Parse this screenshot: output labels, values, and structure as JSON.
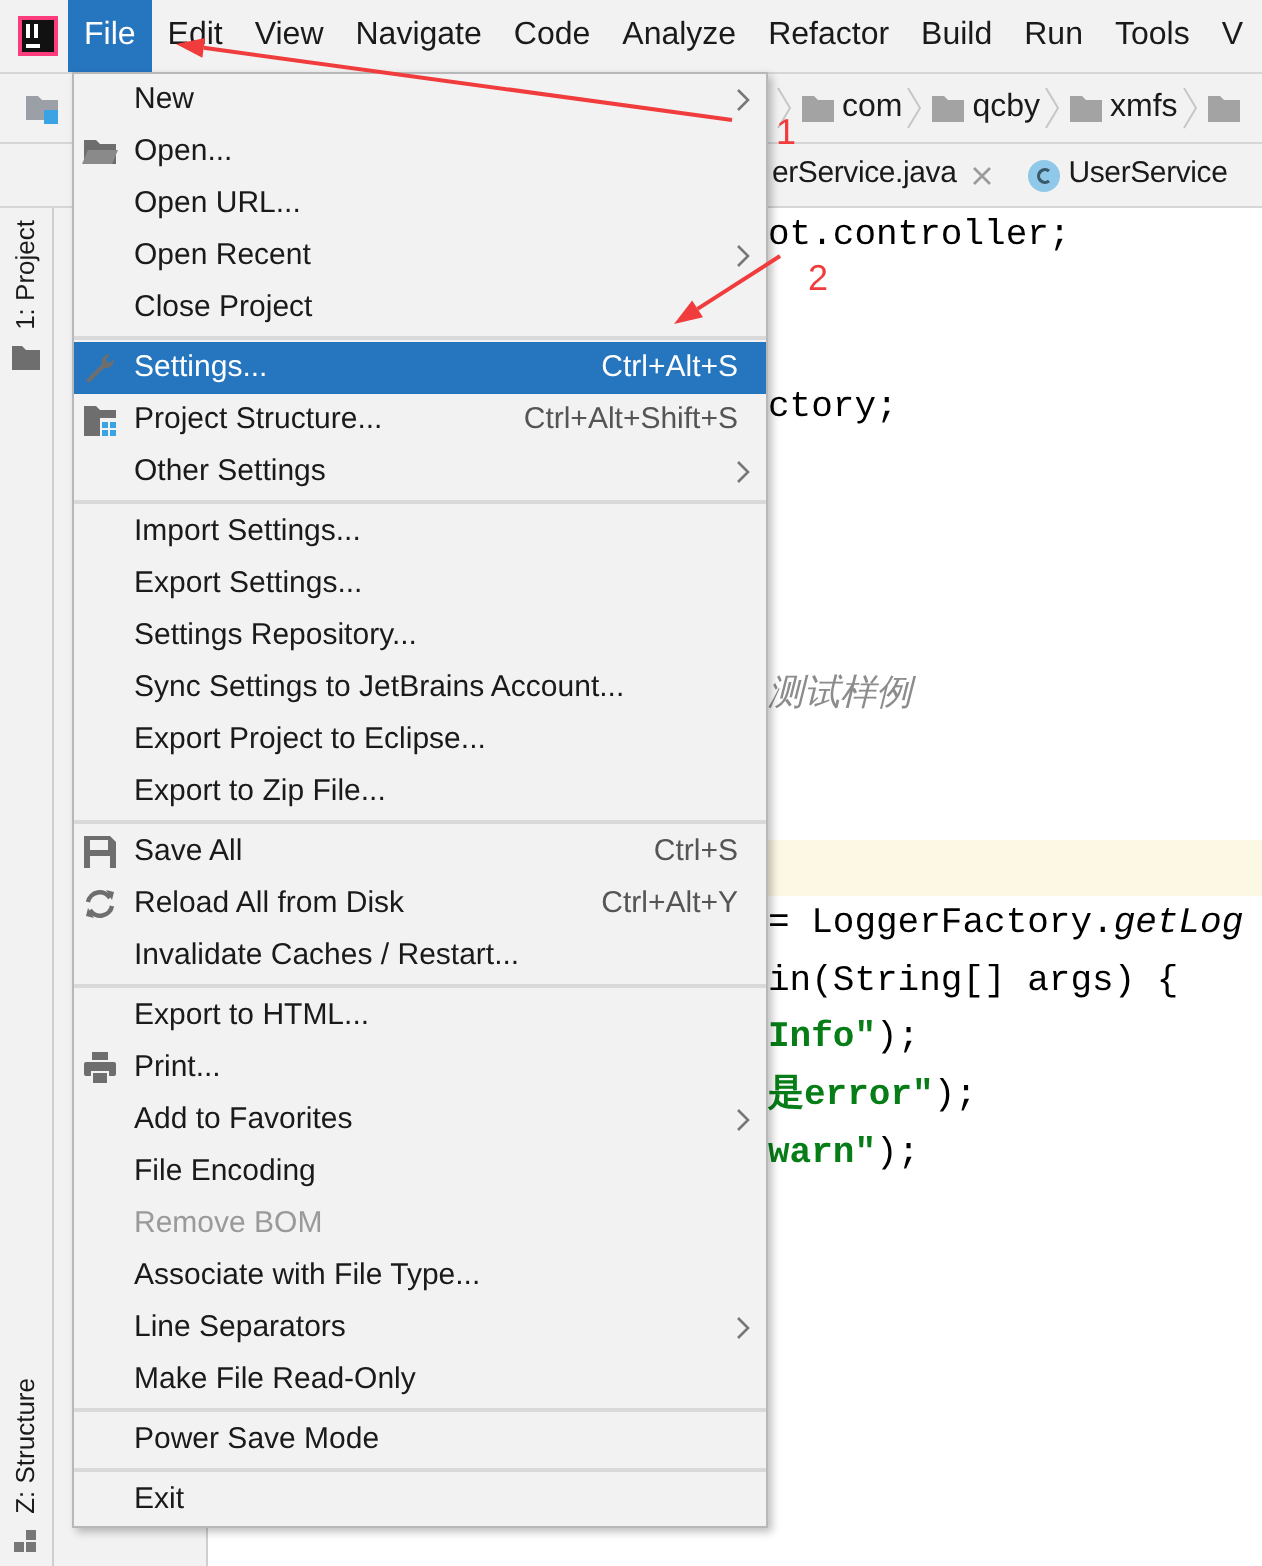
{
  "menubar": [
    {
      "label": "File",
      "selected": true
    },
    {
      "label": "Edit",
      "selected": false
    },
    {
      "label": "View",
      "selected": false
    },
    {
      "label": "Navigate",
      "selected": false
    },
    {
      "label": "Code",
      "selected": false
    },
    {
      "label": "Analyze",
      "selected": false
    },
    {
      "label": "Refactor",
      "selected": false
    },
    {
      "label": "Build",
      "selected": false
    },
    {
      "label": "Run",
      "selected": false
    },
    {
      "label": "Tools",
      "selected": false
    },
    {
      "label": "V",
      "selected": false
    }
  ],
  "breadcrumbs": [
    "com",
    "qcby",
    "xmfs"
  ],
  "editor_tabs": [
    {
      "label": "erService.java",
      "kind": "closable"
    },
    {
      "label": "UserService",
      "kind": "class"
    }
  ],
  "tool_strip": {
    "top": "1: Project",
    "bottom": "Z: Structure"
  },
  "code_lines": [
    {
      "kind": "code",
      "segments": [
        {
          "text": "ot.controller;",
          "kind": "plain"
        }
      ]
    },
    {
      "kind": "blank"
    },
    {
      "kind": "blank"
    },
    {
      "kind": "code",
      "segments": [
        {
          "text": "ctory;",
          "kind": "plain"
        }
      ]
    },
    {
      "kind": "blank"
    },
    {
      "kind": "blank"
    },
    {
      "kind": "blank"
    },
    {
      "kind": "blank"
    },
    {
      "kind": "code",
      "segments": [
        {
          "text": "测试样例",
          "kind": "comment"
        }
      ]
    },
    {
      "kind": "blank"
    },
    {
      "kind": "blank"
    },
    {
      "kind": "blank",
      "current": true
    },
    {
      "kind": "code",
      "segments": [
        {
          "text": "= LoggerFactory.",
          "kind": "plain"
        },
        {
          "text": "getLog",
          "kind": "italic"
        }
      ]
    },
    {
      "kind": "code",
      "segments": [
        {
          "text": "in(String[] args) {",
          "kind": "plain"
        }
      ]
    },
    {
      "kind": "code",
      "segments": [
        {
          "text": "Info\"",
          "kind": "string"
        },
        {
          "text": ");",
          "kind": "plain"
        }
      ]
    },
    {
      "kind": "code",
      "segments": [
        {
          "text": "是error\"",
          "kind": "string"
        },
        {
          "text": ");",
          "kind": "plain"
        }
      ]
    },
    {
      "kind": "code",
      "segments": [
        {
          "text": "warn\"",
          "kind": "string"
        },
        {
          "text": ");",
          "kind": "plain"
        }
      ]
    }
  ],
  "file_menu": {
    "groups": [
      [
        {
          "label": "New",
          "submenu": true,
          "selected": false,
          "disabled": false
        },
        {
          "label": "Open...",
          "kind": "folder",
          "submenu": false,
          "selected": false,
          "disabled": false
        },
        {
          "label": "Open URL...",
          "submenu": false,
          "selected": false,
          "disabled": false
        },
        {
          "label": "Open Recent",
          "submenu": true,
          "selected": false,
          "disabled": false
        },
        {
          "label": "Close Project",
          "submenu": false,
          "selected": false,
          "disabled": false
        }
      ],
      [
        {
          "label": "Settings...",
          "kind": "wrench",
          "shortcut": "Ctrl+Alt+S",
          "submenu": false,
          "selected": true,
          "disabled": false
        },
        {
          "label": "Project Structure...",
          "kind": "structure",
          "shortcut": "Ctrl+Alt+Shift+S",
          "submenu": false,
          "selected": false,
          "disabled": false
        },
        {
          "label": "Other Settings",
          "submenu": true,
          "selected": false,
          "disabled": false
        }
      ],
      [
        {
          "label": "Import Settings...",
          "submenu": false,
          "selected": false,
          "disabled": false
        },
        {
          "label": "Export Settings...",
          "submenu": false,
          "selected": false,
          "disabled": false
        },
        {
          "label": "Settings Repository...",
          "submenu": false,
          "selected": false,
          "disabled": false
        },
        {
          "label": "Sync Settings to JetBrains Account...",
          "submenu": false,
          "selected": false,
          "disabled": false
        },
        {
          "label": "Export Project to Eclipse...",
          "submenu": false,
          "selected": false,
          "disabled": false
        },
        {
          "label": "Export to Zip File...",
          "submenu": false,
          "selected": false,
          "disabled": false
        }
      ],
      [
        {
          "label": "Save All",
          "kind": "save",
          "shortcut": "Ctrl+S",
          "submenu": false,
          "selected": false,
          "disabled": false
        },
        {
          "label": "Reload All from Disk",
          "kind": "reload",
          "shortcut": "Ctrl+Alt+Y",
          "submenu": false,
          "selected": false,
          "disabled": false
        },
        {
          "label": "Invalidate Caches / Restart...",
          "submenu": false,
          "selected": false,
          "disabled": false
        }
      ],
      [
        {
          "label": "Export to HTML...",
          "submenu": false,
          "selected": false,
          "disabled": false
        },
        {
          "label": "Print...",
          "kind": "print",
          "submenu": false,
          "selected": false,
          "disabled": false
        },
        {
          "label": "Add to Favorites",
          "submenu": true,
          "selected": false,
          "disabled": false
        },
        {
          "label": "File Encoding",
          "submenu": false,
          "selected": false,
          "disabled": false
        },
        {
          "label": "Remove BOM",
          "submenu": false,
          "selected": false,
          "disabled": true
        },
        {
          "label": "Associate with File Type...",
          "submenu": false,
          "selected": false,
          "disabled": false
        },
        {
          "label": "Line Separators",
          "submenu": true,
          "selected": false,
          "disabled": false
        },
        {
          "label": "Make File Read-Only",
          "submenu": false,
          "selected": false,
          "disabled": false
        }
      ],
      [
        {
          "label": "Power Save Mode",
          "submenu": false,
          "selected": false,
          "disabled": false
        }
      ],
      [
        {
          "label": "Exit",
          "submenu": false,
          "selected": false,
          "disabled": false
        }
      ]
    ]
  },
  "annotations": [
    {
      "label": "1"
    },
    {
      "label": "2"
    }
  ]
}
